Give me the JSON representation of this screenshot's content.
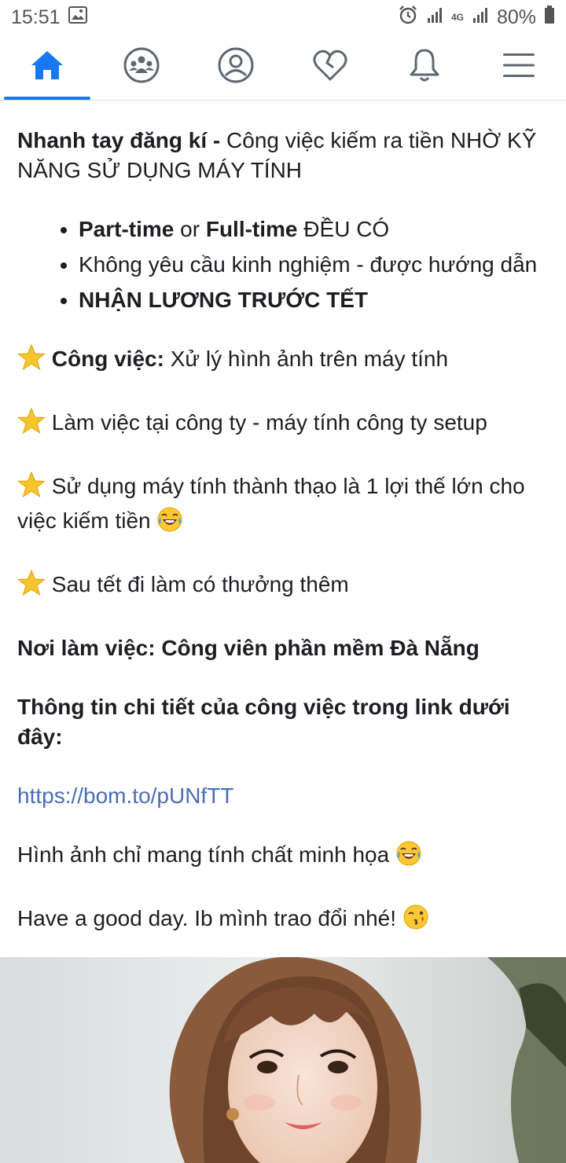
{
  "status_bar": {
    "time": "15:51",
    "battery": "80%",
    "network": "4G"
  },
  "nav": {
    "tabs": [
      {
        "icon": "home-icon",
        "active": true
      },
      {
        "icon": "groups-icon",
        "active": false
      },
      {
        "icon": "profile-icon",
        "active": false
      },
      {
        "icon": "dating-heart-icon",
        "active": false
      },
      {
        "icon": "notifications-bell-icon",
        "active": false
      },
      {
        "icon": "menu-icon",
        "active": false
      }
    ],
    "accent": "#1877f2"
  },
  "post": {
    "intro_bold": "Nhanh tay đăng kí -",
    "intro_rest": " Công việc kiếm ra tiền NHỜ KỸ NĂNG SỬ DỤNG MÁY TÍNH",
    "bullet1_bold1": "Part-time",
    "bullet1_or": " or ",
    "bullet1_bold2": "Full-time",
    "bullet1_rest": " ĐỀU CÓ",
    "bullet2": "Không yêu cầu kinh nghiệm - được hướng dẫn",
    "bullet3": "NHẬN LƯƠNG TRƯỚC TẾT",
    "star1_bold": "Công việc:",
    "star1_rest": " Xử lý hình ảnh trên máy tính",
    "star2": " Làm việc tại công ty - máy tính công ty setup",
    "star3": " Sử dụng máy tính thành thạo là 1 lợi thế lớn cho việc kiếm tiền ",
    "star4": " Sau tết đi làm có thưởng thêm",
    "location": "Nơi làm việc: Công viên phần mềm Đà Nẵng",
    "details": "Thông tin chi tiết của công việc trong link dưới đây:",
    "link": "https://bom.to/pUNfTT",
    "illustration_note": "Hình ảnh chỉ mang tính chất minh họa ",
    "closing": "Have a good day. Ib mình trao đổi nhé! "
  },
  "colors": {
    "link": "#4a6db5",
    "star": "#f7c52b",
    "divider": "#dadde1"
  }
}
